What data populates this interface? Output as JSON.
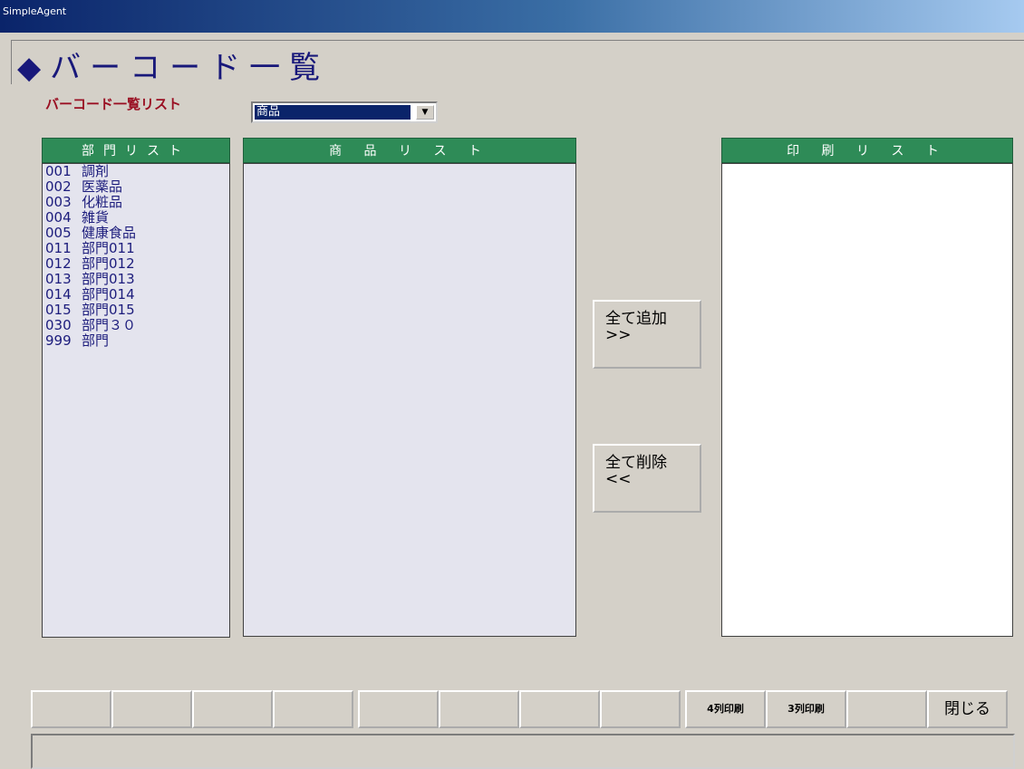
{
  "window": {
    "title": "SimpleAgent"
  },
  "header": {
    "title": "◆バーコード一覧"
  },
  "filter": {
    "label": "バーコード一覧リスト",
    "selected": "商品"
  },
  "dept_list": {
    "header": "部門リスト",
    "items": [
      {
        "code": "001",
        "name": "調剤"
      },
      {
        "code": "002",
        "name": "医薬品"
      },
      {
        "code": "003",
        "name": "化粧品"
      },
      {
        "code": "004",
        "name": "雑貨"
      },
      {
        "code": "005",
        "name": "健康食品"
      },
      {
        "code": "011",
        "name": "部門011"
      },
      {
        "code": "012",
        "name": "部門012"
      },
      {
        "code": "013",
        "name": "部門013"
      },
      {
        "code": "014",
        "name": "部門014"
      },
      {
        "code": "015",
        "name": "部門015"
      },
      {
        "code": "030",
        "name": "部門３０"
      },
      {
        "code": "999",
        "name": "部門"
      }
    ]
  },
  "product_list": {
    "header": "商 品 リ ス ト"
  },
  "print_list": {
    "header": "印 刷 リ ス ト"
  },
  "buttons": {
    "add_all": "全て追加\n>>",
    "remove_all": "全て削除\n<<"
  },
  "function_keys": [
    "",
    "",
    "",
    "",
    "",
    "",
    "",
    "",
    "4列印刷",
    "3列印刷",
    "",
    "閉じる"
  ],
  "status_bar": {
    "text": ""
  }
}
